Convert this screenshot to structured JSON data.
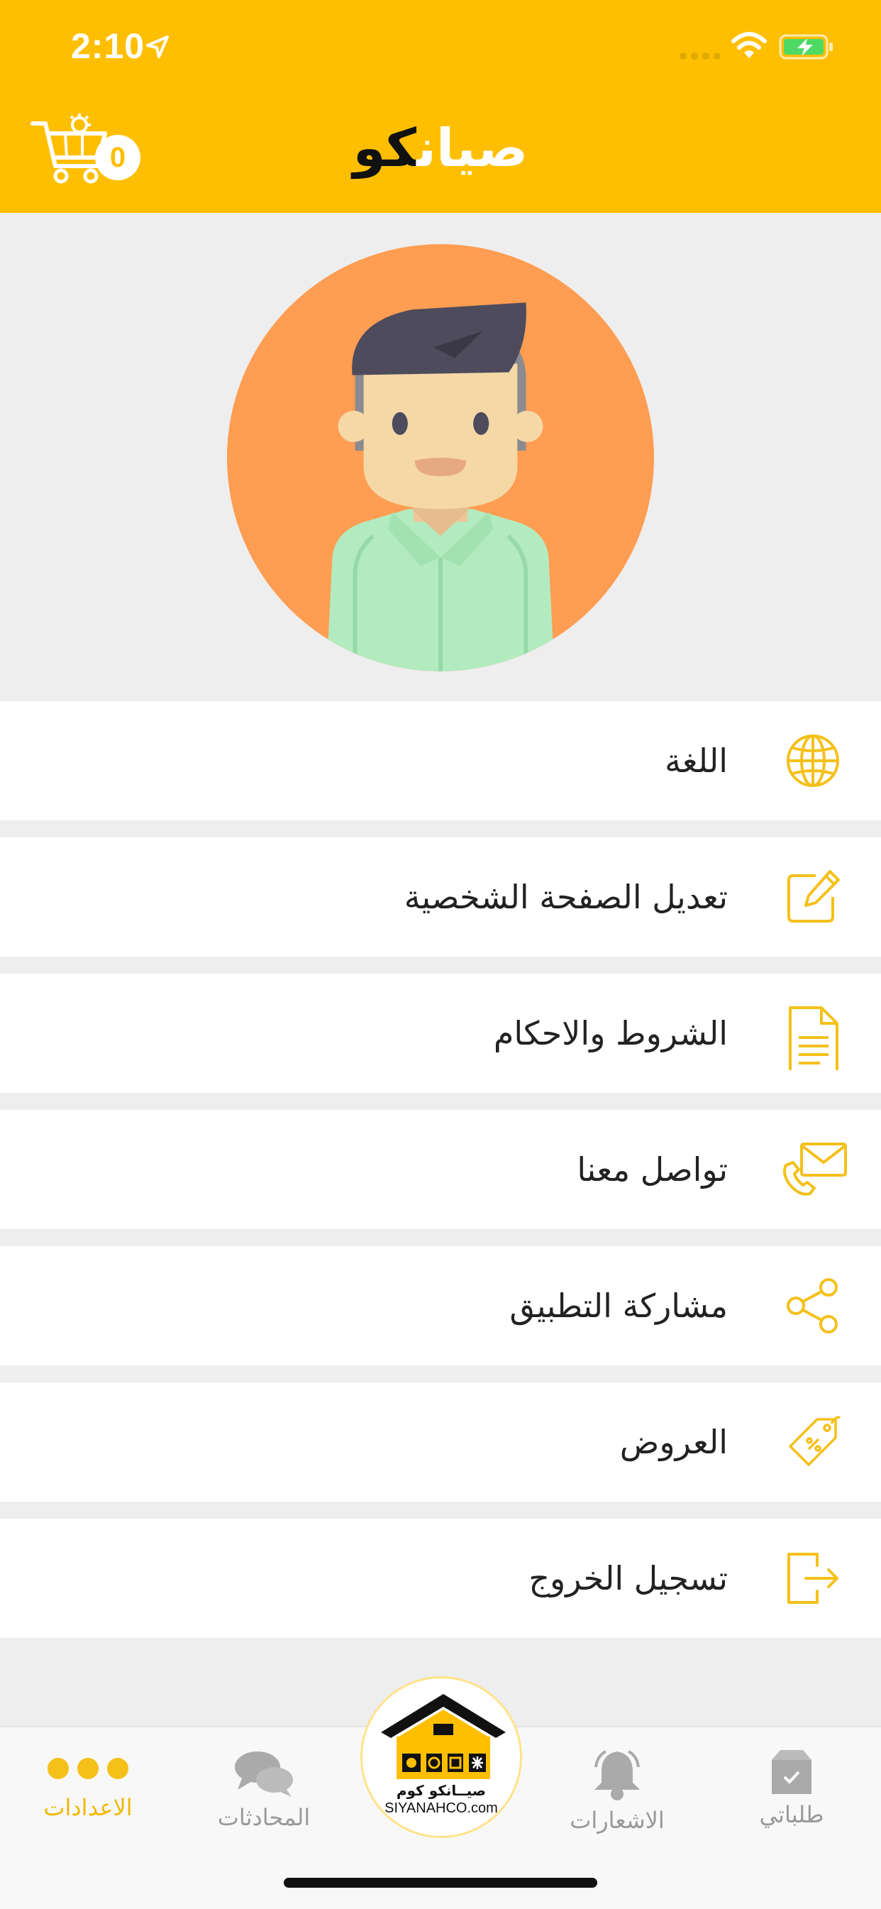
{
  "status_bar": {
    "time": "2:10",
    "icons": [
      "location-arrow-icon",
      "signal-icon",
      "wifi-icon",
      "battery-charging-icon"
    ]
  },
  "header": {
    "logo_part1": "صيان",
    "logo_part2": "كو",
    "cart_count": "0"
  },
  "menu": [
    {
      "label": "اللغة",
      "icon": "globe-icon"
    },
    {
      "label": "تعديل الصفحة الشخصية",
      "icon": "edit-icon"
    },
    {
      "label": "الشروط والاحكام",
      "icon": "document-icon"
    },
    {
      "label": "تواصل معنا",
      "icon": "contact-icon"
    },
    {
      "label": "مشاركة التطبيق",
      "icon": "share-icon"
    },
    {
      "label": "العروض",
      "icon": "tag-icon"
    },
    {
      "label": "تسجيل الخروج",
      "icon": "logout-icon"
    }
  ],
  "tabbar": {
    "settings": "الاعدادات",
    "chats": "المحادثات",
    "notifications": "الاشعارات",
    "orders": "طلباتي",
    "center_brand_ar": "صيــانكو كوم",
    "center_brand_en": "SIYANAHCO.com",
    "active_color": "#f0b800"
  },
  "colors": {
    "brand": "#ffbf00",
    "icon": "#f5c01a",
    "avatar_bg": "#ff9d52"
  }
}
